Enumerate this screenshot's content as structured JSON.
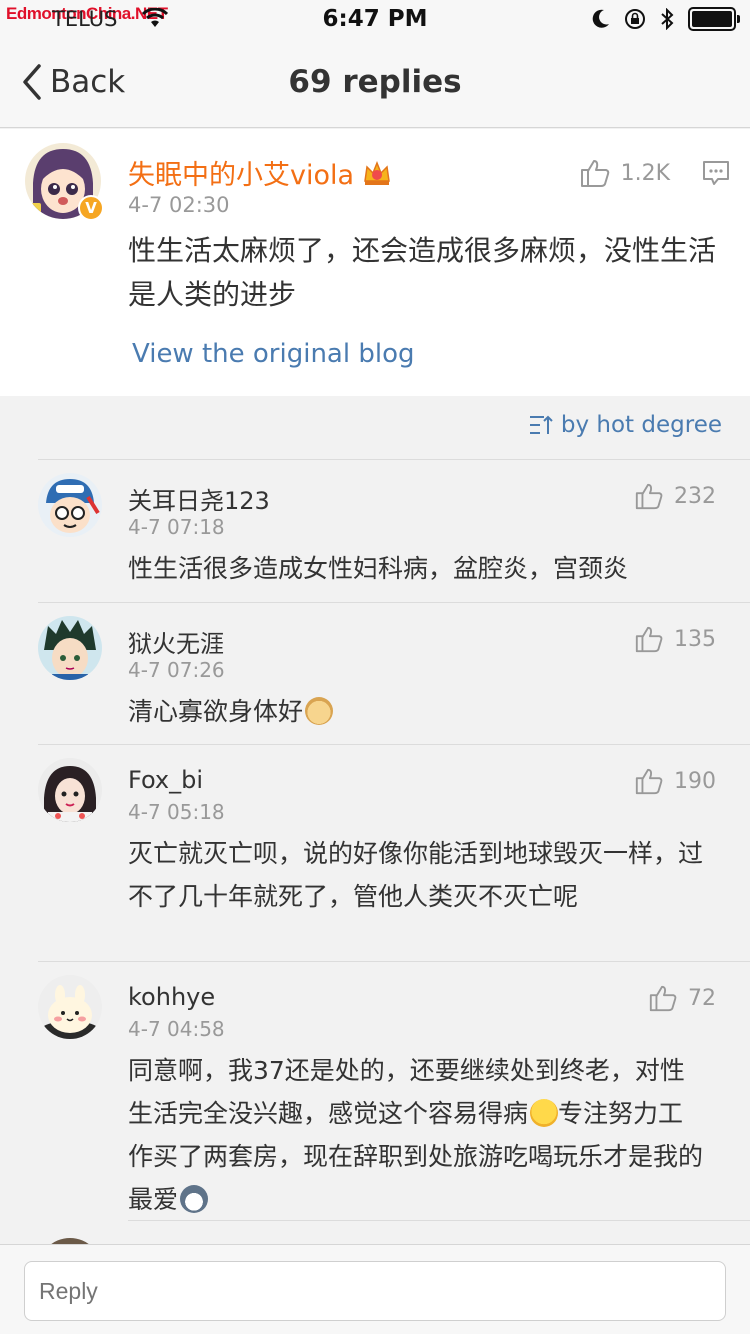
{
  "status_bar": {
    "time": "6:47 PM",
    "carrier": "TELUS",
    "watermark": "EdmontonChina.NET",
    "icons": [
      "signal-icon",
      "wifi-icon",
      "moon-icon",
      "rotation-lock-icon",
      "bluetooth-icon",
      "battery-icon"
    ]
  },
  "nav": {
    "back_label": "Back",
    "title": "69 replies"
  },
  "original_post": {
    "author": "失眠中的小艾viola",
    "time": "4-7 02:30",
    "likes": "1.2K",
    "text": "性生活太麻烦了，还会造成很多麻烦，没性生活是人类的进步",
    "link_label": "View the original blog",
    "badge": "V"
  },
  "sort": {
    "label": "by hot degree"
  },
  "replies": [
    {
      "name": "关耳日尧123",
      "time": "4-7 07:18",
      "likes": "232",
      "text": "性生活很多造成女性妇科病，盆腔炎，宫颈炎"
    },
    {
      "name": "狱火无涯",
      "time": "4-7 07:26",
      "likes": "135",
      "text": "清心寡欲身体好"
    },
    {
      "name": "Fox_bi",
      "time": "4-7 05:18",
      "likes": "190",
      "text": "灭亡就灭亡呗，说的好像你能活到地球毁灭一样，过不了几十年就死了，管他人类灭不灭亡呢"
    },
    {
      "name": "kohhye",
      "time": "4-7 04:58",
      "likes": "72",
      "text_a": "同意啊，我37还是处的，还要继续处到终老，对性生活完全没兴趣，感觉这个容易得病",
      "text_b": "专注努力工作买了两套房，现在辞职到处旅游吃喝玩乐才是我的最爱"
    }
  ],
  "reply_input": {
    "placeholder": "Reply"
  },
  "colors": {
    "author_orange": "#f36f14",
    "link_blue": "#4a7bb0",
    "secondary_gray": "#999999"
  }
}
